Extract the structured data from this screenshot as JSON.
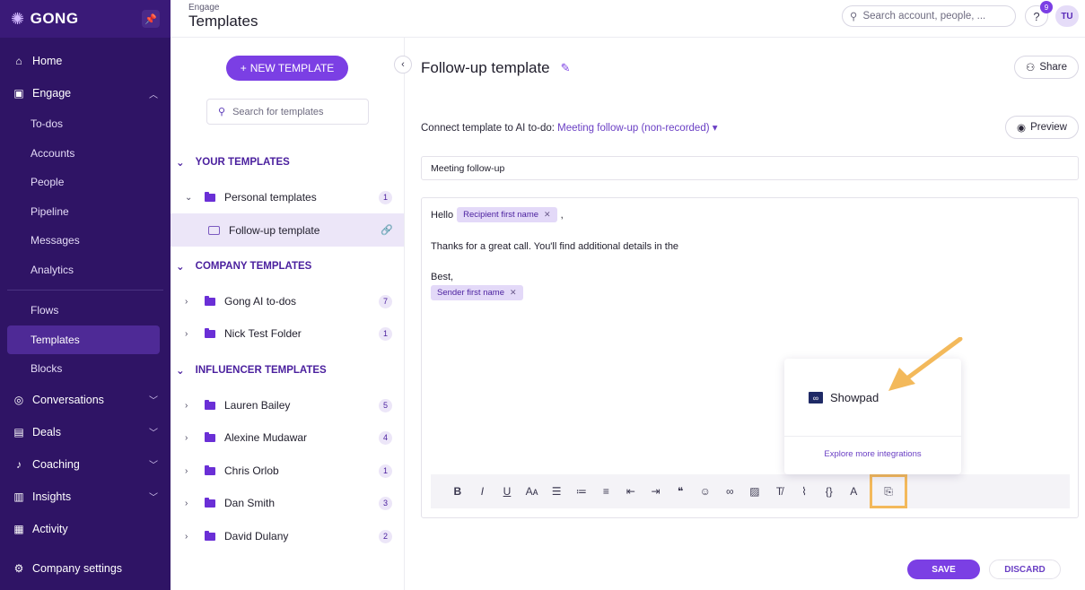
{
  "app": {
    "logo": "GONG"
  },
  "header": {
    "section": "Engage",
    "title": "Templates",
    "search_placeholder": "Search account, people, ...",
    "help": "?",
    "notifications": "9",
    "avatar": "TU"
  },
  "sidebar": {
    "home": "Home",
    "engage": "Engage",
    "engage_items": [
      "To-dos",
      "Accounts",
      "People",
      "Pipeline",
      "Messages",
      "Analytics"
    ],
    "tools": [
      "Flows",
      "Templates",
      "Blocks"
    ],
    "conversations": "Conversations",
    "deals": "Deals",
    "coaching": "Coaching",
    "insights": "Insights",
    "activity": "Activity",
    "settings": "Company settings"
  },
  "list": {
    "new_button": "NEW TEMPLATE",
    "search_placeholder": "Search for templates",
    "your_templates": "YOUR TEMPLATES",
    "personal_folder": {
      "name": "Personal templates",
      "count": "1"
    },
    "selected_template": "Follow-up template",
    "company_templates": "COMPANY TEMPLATES",
    "company_folders": [
      {
        "name": "Gong AI to-dos",
        "count": "7"
      },
      {
        "name": "Nick Test Folder",
        "count": "1"
      }
    ],
    "influencer_templates": "INFLUENCER TEMPLATES",
    "influencer_folders": [
      {
        "name": "Lauren Bailey",
        "count": "5"
      },
      {
        "name": "Alexine Mudawar",
        "count": "4"
      },
      {
        "name": "Chris Orlob",
        "count": "1"
      },
      {
        "name": "Dan Smith",
        "count": "3"
      },
      {
        "name": "David Dulany",
        "count": "2"
      }
    ]
  },
  "editor": {
    "title": "Follow-up template",
    "share": "Share",
    "connect_label": "Connect template to AI to-do:",
    "connect_value": "Meeting follow-up (non-recorded)",
    "preview": "Preview",
    "subject": "Meeting follow-up",
    "greeting": "Hello",
    "recipient_chip": "Recipient first name",
    "comma": ",",
    "body_line": "Thanks for a great call. You'll find additional details in the",
    "signoff": "Best,",
    "sender_chip": "Sender first name",
    "integration_name": "Showpad",
    "explore_link": "Explore more integrations",
    "save": "SAVE",
    "discard": "DISCARD"
  },
  "colors": {
    "sidebar": "#2f1465",
    "accent": "#7b3fe4",
    "highlight": "#f3b95b"
  }
}
